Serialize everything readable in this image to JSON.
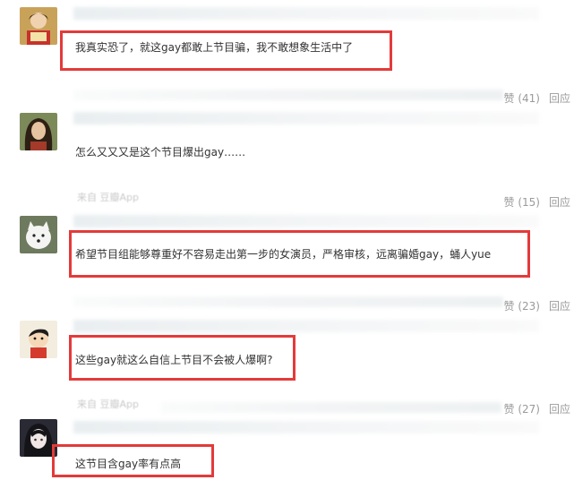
{
  "accent_color": "#e43a3a",
  "comments": [
    {
      "text": "我真实恐了，就这gay都敢上节目骗，我不敢想象生活中了",
      "source": "",
      "avatar": "lady-red-avatar"
    },
    {
      "text": "怎么又又又是这个节目爆出gay……",
      "source": "",
      "like_label": "赞 (41)",
      "reply_label": "回应",
      "avatar": "long-hair-avatar"
    },
    {
      "text": "希望节目组能够尊重好不容易走出第一步的女演员，严格审核，远离骗婚gay，蛹人yue",
      "source": "来自 豆瓣App",
      "like_label": "赞 (15)",
      "reply_label": "回应",
      "avatar": "white-dog-avatar"
    },
    {
      "text": "这些gay就这么自信上节目不会被人爆啊?",
      "source": "",
      "like_label": "赞 (23)",
      "reply_label": "回应",
      "avatar": "cartoon-boy-avatar"
    },
    {
      "text": "这节目含gay率有点高",
      "source": "来自 豆瓣App",
      "like_label": "赞 (27)",
      "reply_label": "回应",
      "avatar": "anime-girl-avatar"
    }
  ]
}
